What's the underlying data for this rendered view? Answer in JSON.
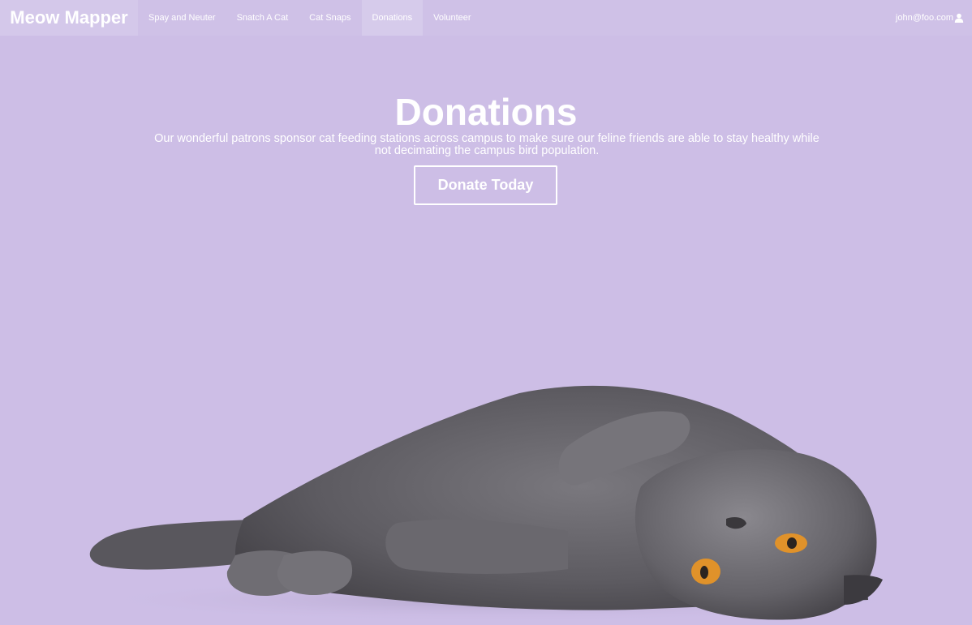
{
  "colors": {
    "background": "#cdbee6",
    "text": "#ffffff",
    "cat_fur": "#66646a",
    "cat_eye": "#e0922a"
  },
  "nav": {
    "brand": "Meow Mapper",
    "items": [
      {
        "label": "Spay and Neuter"
      },
      {
        "label": "Snatch A Cat"
      },
      {
        "label": "Cat Snaps"
      },
      {
        "label": "Donations",
        "active": true
      },
      {
        "label": "Volunteer"
      }
    ],
    "user": "john@foo.com",
    "user_icon": "user-icon"
  },
  "hero": {
    "title": "Donations",
    "text_line1": "Our wonderful patrons sponsor cat feeding stations across campus to make sure our feline friends are able to stay healthy while",
    "text_line2": "not decimating the campus bird population.",
    "button": "Donate Today"
  },
  "image": {
    "subject": "gray cat lying on its side"
  }
}
